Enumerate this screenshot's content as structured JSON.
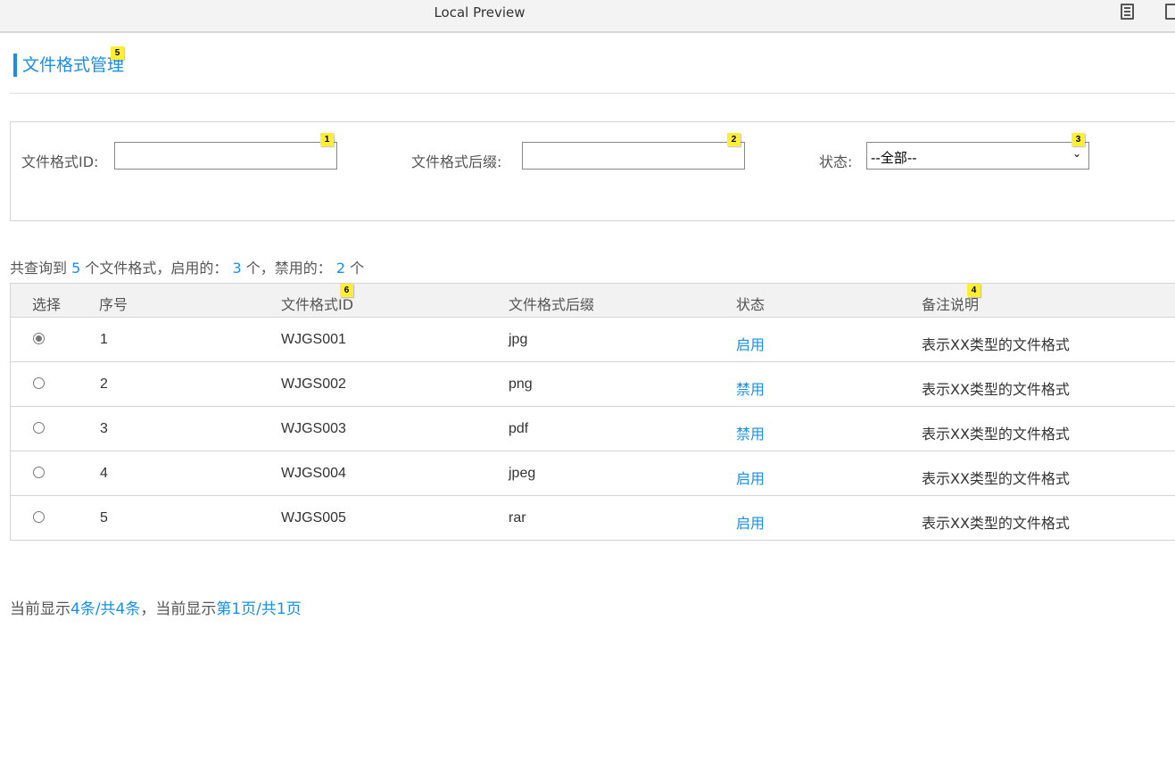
{
  "window": {
    "title": "Local Preview"
  },
  "page": {
    "title": "文件格式管理"
  },
  "filters": {
    "id_label": "文件格式ID:",
    "id_value": "",
    "suffix_label": "文件格式后缀:",
    "suffix_value": "",
    "status_label": "状态:",
    "status_selected": "--全部--"
  },
  "summary": {
    "prefix": "共查询到",
    "total": "5",
    "mid1": "个文件格式，启用的：",
    "enabled": "3",
    "mid2": "个，禁用的：",
    "disabled": "2",
    "suffix": "个"
  },
  "table": {
    "headers": [
      "选择",
      "序号",
      "文件格式ID",
      "文件格式后缀",
      "状态",
      "备注说明"
    ],
    "rows": [
      {
        "selected": true,
        "no": "1",
        "id": "WJGS001",
        "suffix": "jpg",
        "status": "启用",
        "remark": "表示XX类型的文件格式"
      },
      {
        "selected": false,
        "no": "2",
        "id": "WJGS002",
        "suffix": "png",
        "status": "禁用",
        "remark": "表示XX类型的文件格式"
      },
      {
        "selected": false,
        "no": "3",
        "id": "WJGS003",
        "suffix": "pdf",
        "status": "禁用",
        "remark": "表示XX类型的文件格式"
      },
      {
        "selected": false,
        "no": "4",
        "id": "WJGS004",
        "suffix": "jpeg",
        "status": "启用",
        "remark": "表示XX类型的文件格式"
      },
      {
        "selected": false,
        "no": "5",
        "id": "WJGS005",
        "suffix": "rar",
        "status": "启用",
        "remark": "表示XX类型的文件格式"
      }
    ]
  },
  "pager": {
    "p1": "当前显示",
    "count": "4条/共4条",
    "p2": "，当前显示",
    "page": "第1页/共1页"
  },
  "badges": [
    "1",
    "2",
    "3",
    "4",
    "5",
    "6"
  ],
  "colors": {
    "accent": "#1a8fe6",
    "badge": "#ffee33"
  },
  "icons": {
    "toolbar": [
      "document-icon",
      "expand-icon"
    ],
    "select": "chevron-down-icon"
  }
}
